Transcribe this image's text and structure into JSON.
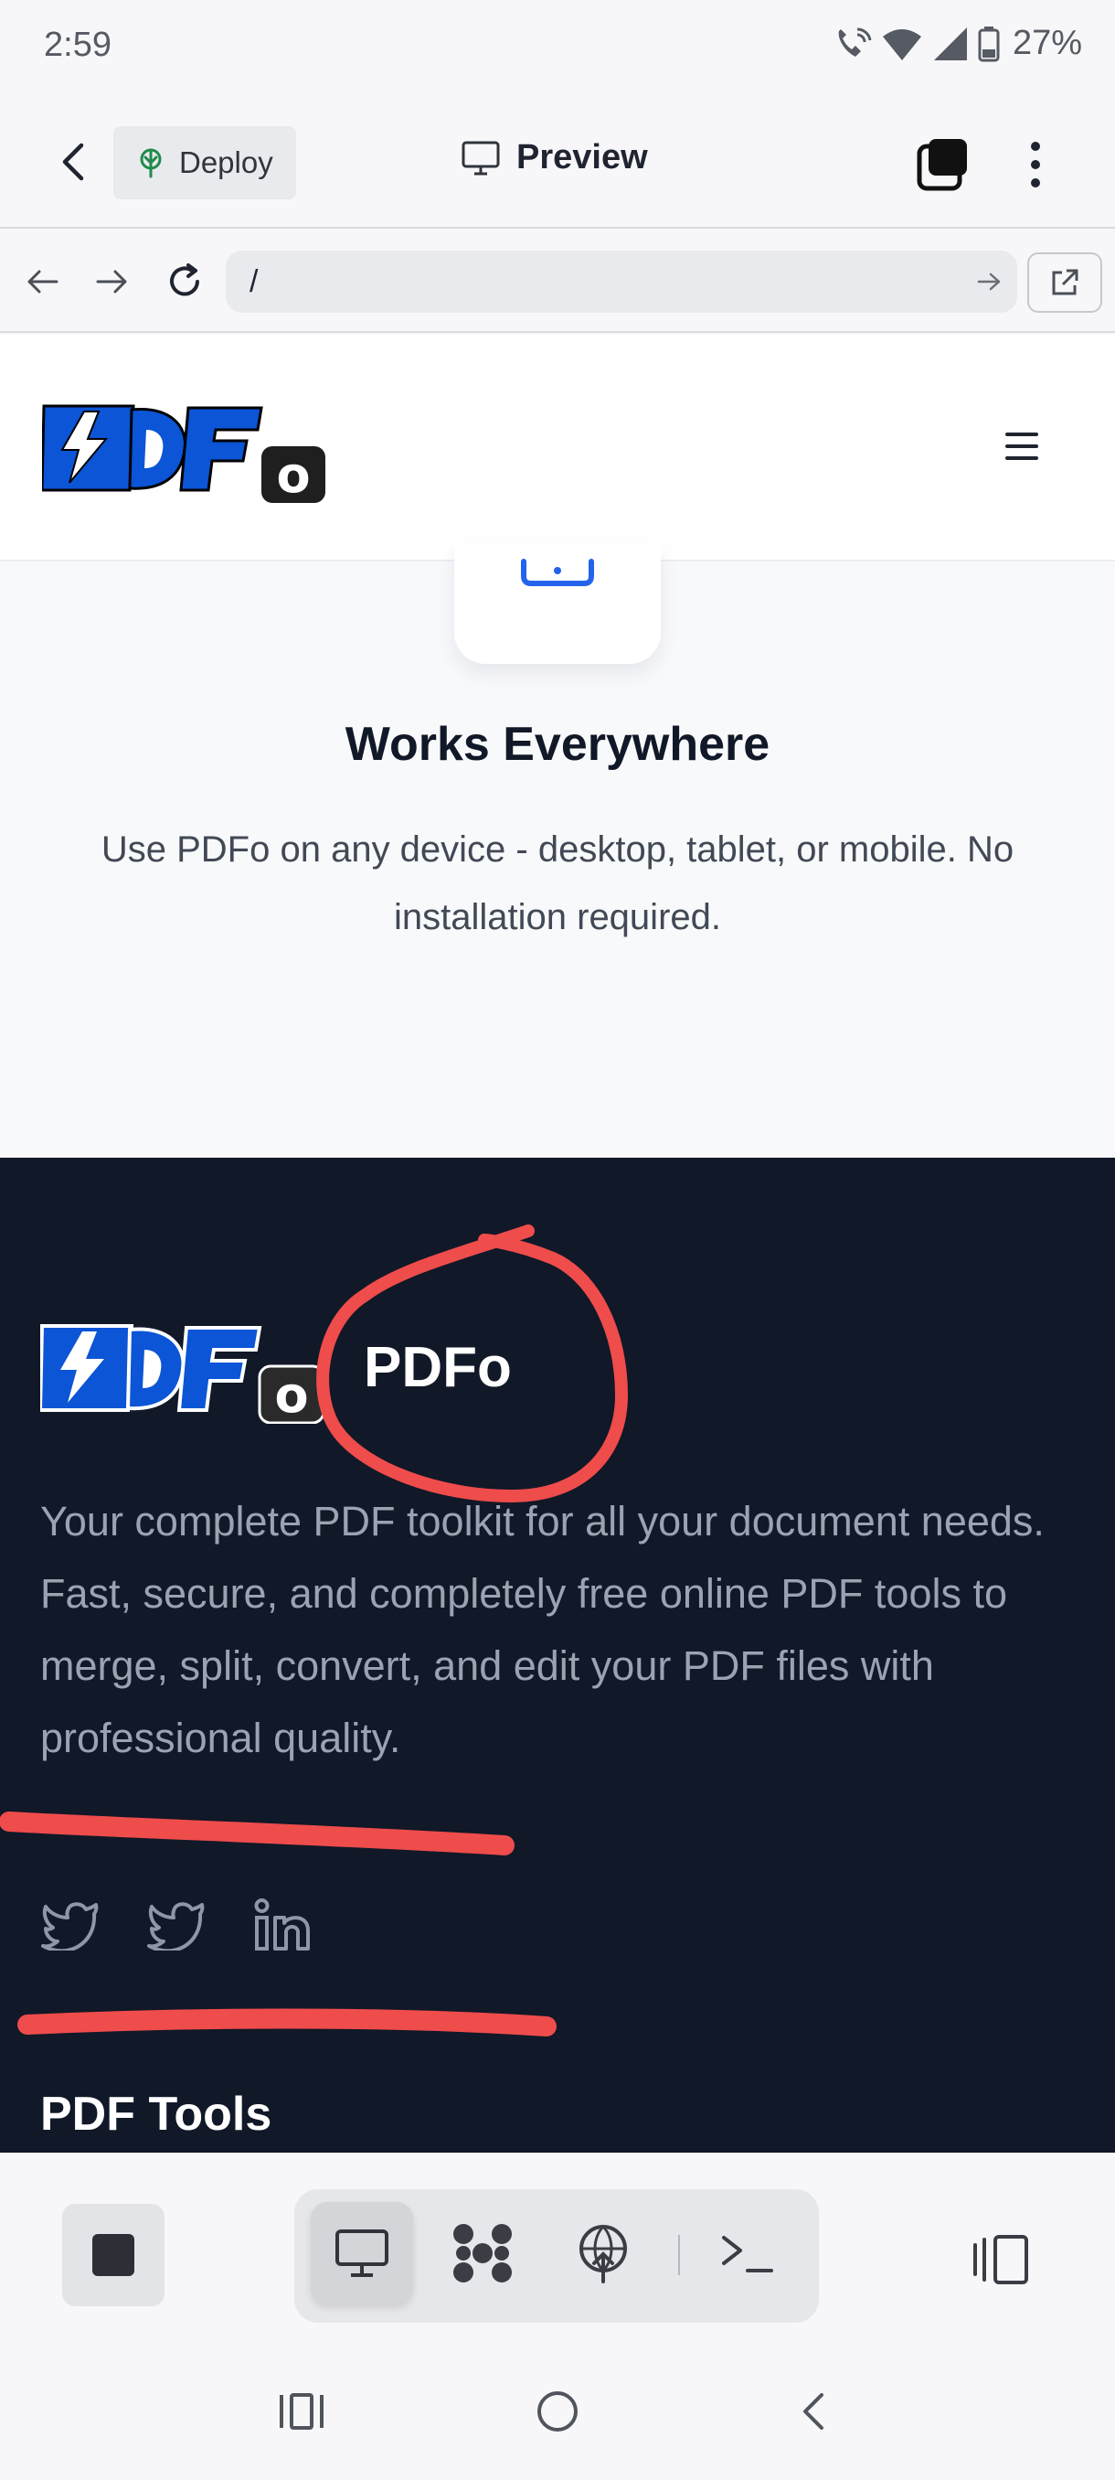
{
  "status_bar": {
    "time": "2:59",
    "battery": "27%"
  },
  "app_bar": {
    "deploy_label": "Deploy",
    "preview_label": "Preview"
  },
  "url_bar": {
    "url": "/"
  },
  "feature": {
    "title": "Works Everywhere",
    "description": "Use PDFo on any device - desktop, tablet, or mobile. No installation required."
  },
  "footer": {
    "brand": "PDFo",
    "description": "Your complete PDF toolkit for all your document needs. Fast, secure, and completely free online PDF tools to merge, split, convert, and edit your PDF files with professional quality.",
    "socials": [
      "twitter-icon",
      "twitter-icon",
      "linkedin-icon"
    ],
    "section_heading": "PDF Tools"
  },
  "logo": {
    "text": "PDF",
    "badge": "o"
  },
  "colors": {
    "brand_blue": "#0b55d6",
    "footer_bg": "#111827",
    "annotation_red": "#ef4c4c",
    "deploy_icon_green": "#1f8a4c"
  }
}
